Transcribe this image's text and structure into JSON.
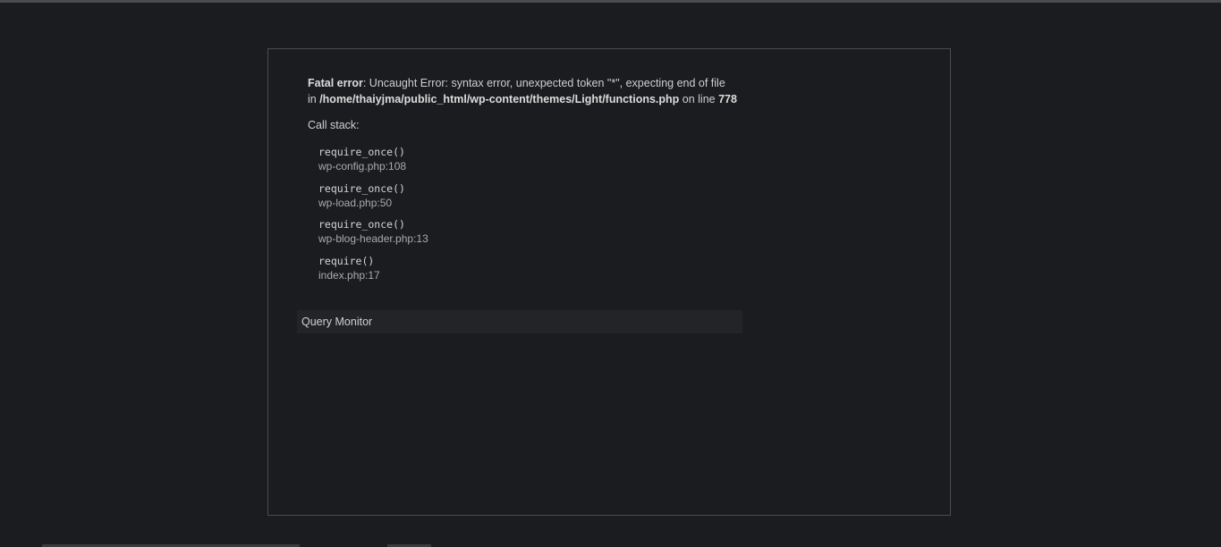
{
  "error": {
    "label": "Fatal error",
    "sep": ": ",
    "message": "Uncaught Error: syntax error, unexpected token \"*\", expecting end of file",
    "in_text": "in ",
    "file": "/home/thaiyjma/public_html/wp-content/themes/Light/functions.php",
    "on_line_text": " on line ",
    "line": "778"
  },
  "call_stack": {
    "label": "Call stack:",
    "frames": [
      {
        "function": "require_once()",
        "location": "wp-config.php:108"
      },
      {
        "function": "require_once()",
        "location": "wp-load.php:50"
      },
      {
        "function": "require_once()",
        "location": "wp-blog-header.php:13"
      },
      {
        "function": "require()",
        "location": "index.php:17"
      }
    ]
  },
  "query_monitor": {
    "label": "Query Monitor"
  }
}
